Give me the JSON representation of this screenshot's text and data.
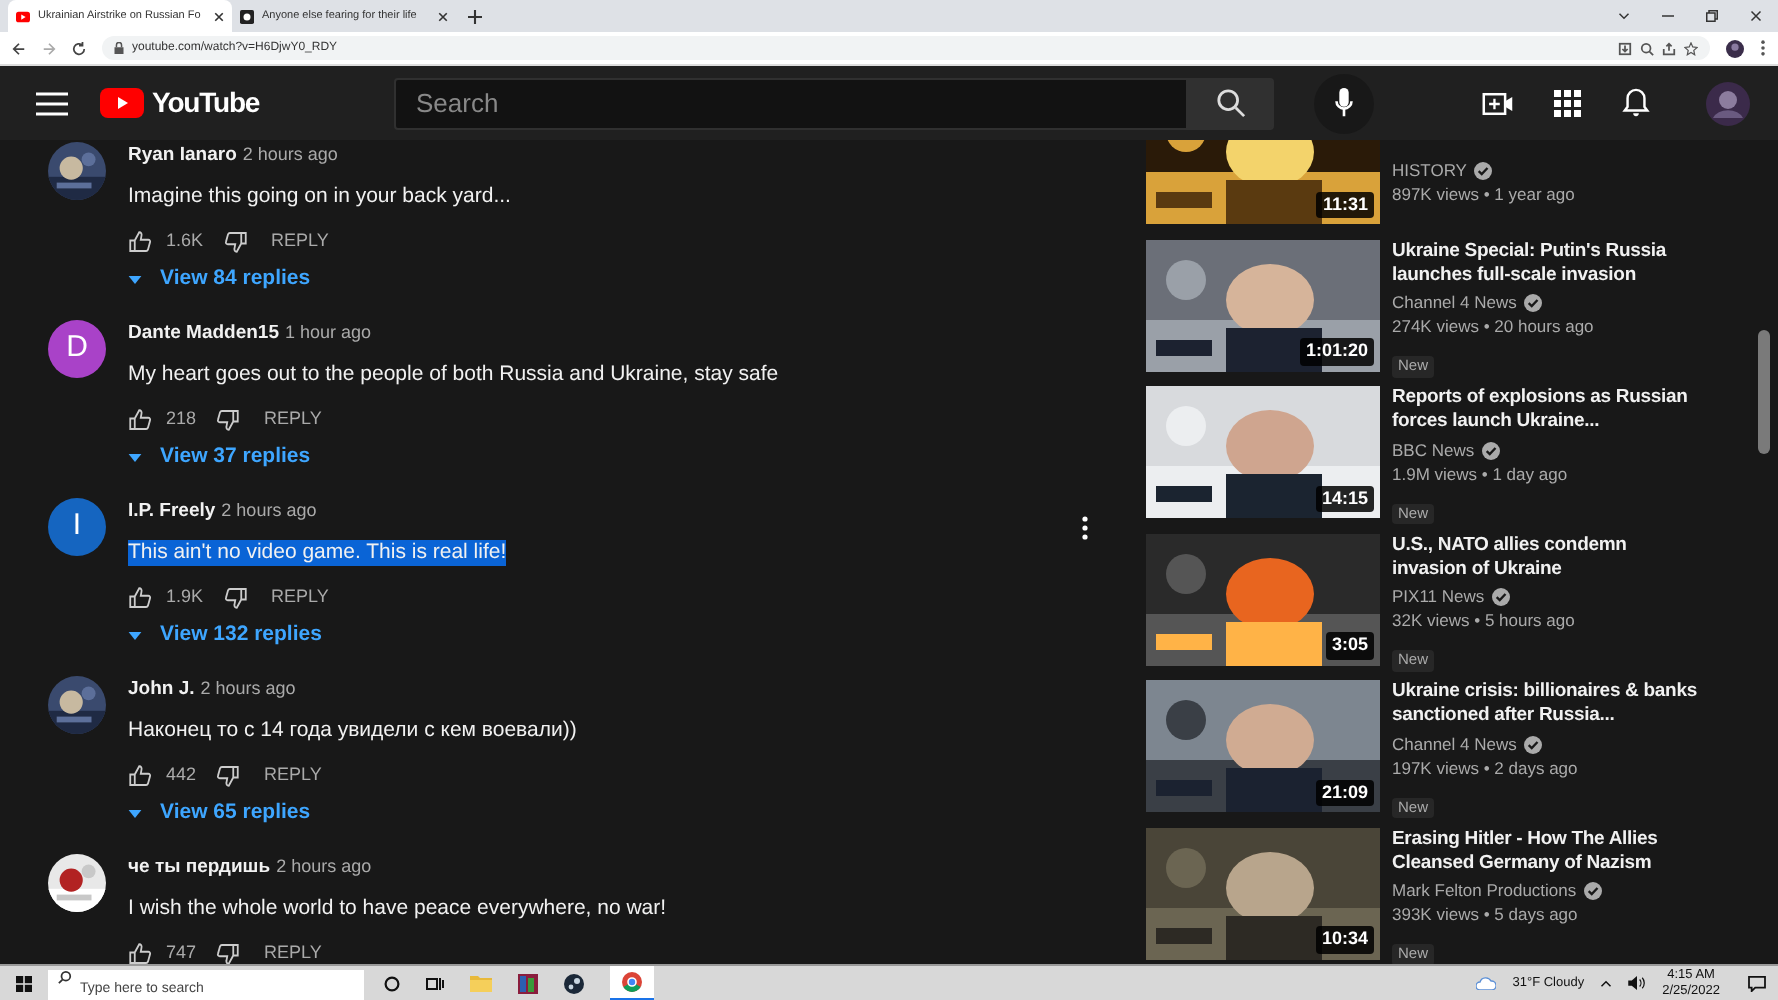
{
  "browser": {
    "tabs": [
      {
        "title": "Ukrainian Airstrike on Russian Fo",
        "selected": true
      },
      {
        "title": "Anyone else fearing for their life",
        "selected": false
      }
    ],
    "url": "youtube.com/watch?v=H6DjwY0_RDY"
  },
  "header": {
    "logo_text": "YouTube",
    "search": {
      "placeholder": "Search"
    }
  },
  "comments": [
    {
      "author": "Ryan Ianaro",
      "time": "2 hours ago",
      "text": "Imagine this going on in your back yard...",
      "likes": "1.6K",
      "reply": "REPLY",
      "replies": "View 84 replies",
      "text_selected": false,
      "menu_shown": false
    },
    {
      "author": "Dante Madden15",
      "time": "1 hour ago",
      "text": "My heart goes out to the people of both Russia and Ukraine, stay safe",
      "likes": "218",
      "reply": "REPLY",
      "replies": "View 37 replies",
      "avatar": {
        "kind": "letter",
        "letter": "D",
        "color": "#a942c8"
      },
      "text_selected": false,
      "menu_shown": false
    },
    {
      "author": "I.P. Freely",
      "time": "2 hours ago",
      "text": "This ain't no video game. This is real life!",
      "likes": "1.9K",
      "reply": "REPLY",
      "replies": "View 132 replies",
      "avatar": {
        "kind": "letter",
        "letter": "I",
        "color": "#1565c0"
      },
      "text_selected": true,
      "menu_shown": true
    },
    {
      "author": "John J.",
      "time": "2 hours ago",
      "text": "Наконец то с 14 года увидели с кем воевали))",
      "likes": "442",
      "reply": "REPLY",
      "replies": "View 65 replies",
      "text_selected": false,
      "menu_shown": false
    },
    {
      "author": "че ты пердишь",
      "time": "2 hours ago",
      "text": "I wish the whole world to have peace everywhere, no war!",
      "likes": "747",
      "reply": "REPLY",
      "text_selected": false,
      "menu_shown": false
    }
  ],
  "related": [
    {
      "channel": "HISTORY",
      "verified": true,
      "meta": "897K views • 1 year ago",
      "duration": "11:31"
    },
    {
      "title": "Ukraine Special: Putin's Russia launches full-scale invasion",
      "channel": "Channel 4 News",
      "verified": true,
      "meta": "274K views • 20 hours ago",
      "badge": "New",
      "duration": "1:01:20"
    },
    {
      "title": "Reports of explosions as Russian forces launch Ukraine...",
      "channel": "BBC News",
      "verified": true,
      "meta": "1.9M views • 1 day ago",
      "badge": "New",
      "duration": "14:15"
    },
    {
      "title": "U.S., NATO allies condemn invasion of Ukraine",
      "channel": "PIX11 News",
      "verified": true,
      "meta": "32K views • 5 hours ago",
      "badge": "New",
      "duration": "3:05"
    },
    {
      "title": "Ukraine crisis: billionaires & banks sanctioned after Russia...",
      "channel": "Channel 4 News",
      "verified": true,
      "meta": "197K views • 2 days ago",
      "badge": "New",
      "duration": "21:09"
    },
    {
      "title": "Erasing Hitler - How The Allies Cleansed Germany of Nazism",
      "channel": "Mark Felton Productions",
      "verified": true,
      "meta": "393K views • 5 days ago",
      "badge": "New",
      "duration": "10:34"
    }
  ],
  "taskbar": {
    "search": {
      "placeholder": "Type here to search"
    },
    "weather": "31°F  Cloudy",
    "time": "4:15 AM",
    "date": "2/25/2022"
  }
}
